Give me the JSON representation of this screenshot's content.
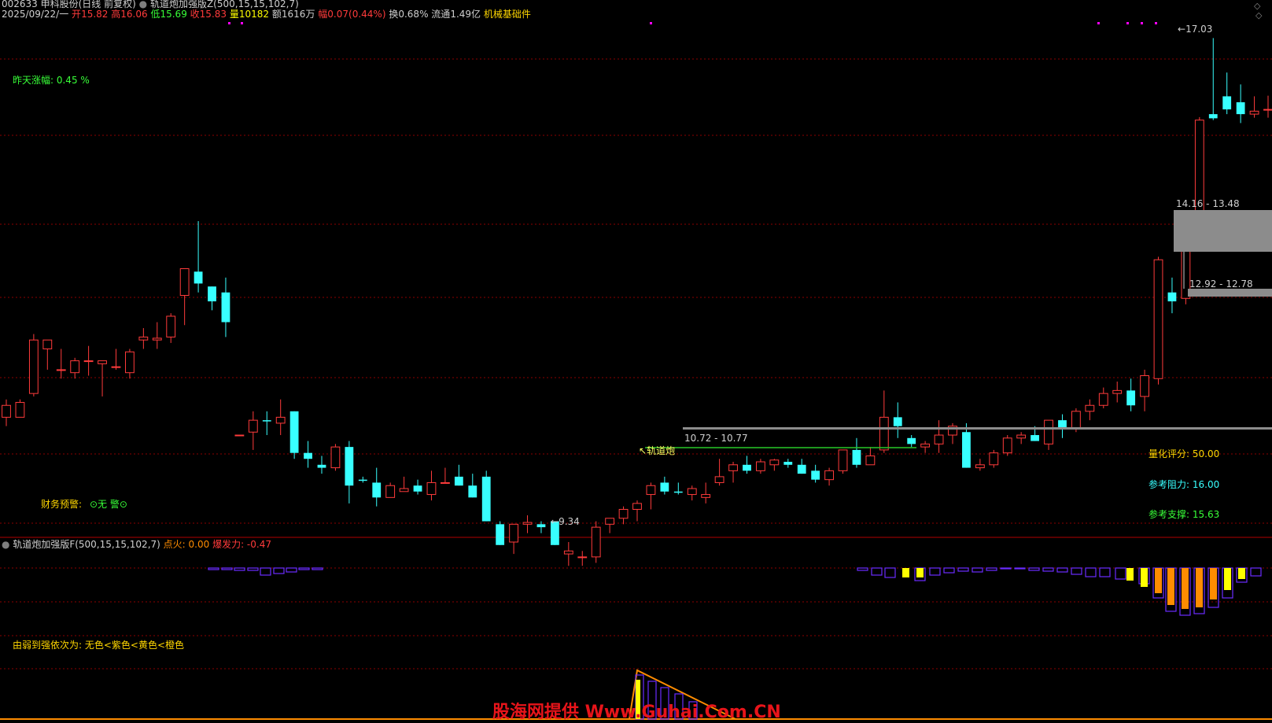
{
  "header": {
    "code_name": "002633 申科股份(日线 前复权)",
    "indicator": "轨道炮加强版Z(500,15,15,102,7)",
    "date": "2025/09/22/一",
    "open_label": "开",
    "open": "15.82",
    "high_label": "高",
    "high": "16.06",
    "low_label": "低",
    "low": "15.69",
    "close_label": "收",
    "close": "15.83",
    "vol_label": "量",
    "vol": "10182",
    "amount_label": "额",
    "amount": "1616万",
    "change_label": "幅",
    "change": "0.07(0.44%)",
    "turnover_label": "换",
    "turnover": "0.68%",
    "float_label": "流通",
    "float": "1.49亿",
    "sector": "机械基础件"
  },
  "labels": {
    "yesterday": "昨天涨幅: 0.45 %",
    "finance_warn_label": "财务预警:",
    "finance_warn_value": "⊙无 警⊙",
    "quant_score": "量化评分: 50.00",
    "resistance": "参考阻力: 16.00",
    "support": "参考支撑: 15.63",
    "sub_title": "轨道炮加强版F(500,15,15,102,7)",
    "ignite": "点火: 0.00",
    "burst": "爆发力: -0.47",
    "strength_legend": "由弱到强依次为: 无色<紫色<黄色<橙色",
    "watermark": "股海网提供 Www.Guhai.Com.CN"
  },
  "chart_data": {
    "type": "candlestick",
    "annotations": {
      "high": "17.03",
      "low": "9.34",
      "signal": "轨道炮",
      "zone_upper": "14.16 - 13.48",
      "zone_mid": "12.92 - 12.78",
      "zone_low": "10.72 - 10.77"
    },
    "ylim": [
      9.0,
      17.3
    ],
    "candles": [
      [
        10.65,
        10.95,
        10.5,
        10.85
      ],
      [
        10.65,
        10.95,
        10.65,
        10.9
      ],
      [
        11.05,
        12.05,
        11.0,
        11.95
      ],
      [
        11.8,
        11.95,
        11.45,
        11.95
      ],
      [
        11.45,
        11.8,
        11.3,
        11.45
      ],
      [
        11.4,
        11.65,
        11.3,
        11.6
      ],
      [
        11.6,
        11.85,
        11.35,
        11.6
      ],
      [
        11.55,
        11.55,
        11.0,
        11.6
      ],
      [
        11.5,
        11.8,
        11.45,
        11.5
      ],
      [
        11.4,
        11.8,
        11.3,
        11.75
      ],
      [
        11.95,
        12.15,
        11.8,
        12.0
      ],
      [
        11.95,
        12.25,
        11.8,
        11.98
      ],
      [
        12.0,
        12.4,
        11.9,
        12.35
      ],
      [
        12.7,
        13.1,
        12.2,
        13.15
      ],
      [
        13.1,
        13.95,
        12.75,
        12.9
      ],
      [
        12.85,
        12.85,
        12.45,
        12.6
      ],
      [
        12.75,
        13.0,
        12.0,
        12.25
      ],
      [
        10.35,
        10.35,
        10.35,
        10.35
      ],
      [
        10.4,
        10.75,
        10.1,
        10.6
      ],
      [
        10.6,
        10.75,
        10.35,
        10.58
      ],
      [
        10.55,
        10.95,
        10.35,
        10.65
      ],
      [
        10.75,
        10.75,
        9.95,
        10.05
      ],
      [
        10.05,
        10.25,
        9.8,
        9.95
      ],
      [
        9.85,
        10.0,
        9.7,
        9.8
      ],
      [
        9.8,
        10.2,
        9.75,
        10.15
      ],
      [
        10.15,
        10.25,
        9.2,
        9.5
      ],
      [
        9.6,
        9.65,
        9.55,
        9.58
      ],
      [
        9.55,
        9.8,
        9.15,
        9.3
      ],
      [
        9.3,
        9.55,
        9.35,
        9.5
      ],
      [
        9.4,
        9.65,
        9.4,
        9.45
      ],
      [
        9.5,
        9.6,
        9.35,
        9.4
      ],
      [
        9.35,
        9.75,
        9.25,
        9.55
      ],
      [
        9.55,
        9.8,
        9.6,
        9.55
      ],
      [
        9.65,
        9.85,
        9.7,
        9.5
      ],
      [
        9.5,
        9.7,
        9.65,
        9.3
      ],
      [
        9.65,
        9.75,
        9.55,
        8.9
      ],
      [
        8.85,
        8.9,
        8.6,
        8.5
      ],
      [
        8.55,
        8.65,
        8.35,
        8.85
      ],
      [
        8.85,
        9.0,
        8.7,
        8.88
      ],
      [
        8.85,
        8.9,
        8.7,
        8.8
      ],
      [
        8.9,
        8.6,
        8.5,
        8.5
      ],
      [
        8.35,
        8.55,
        8.15,
        8.4
      ],
      [
        8.3,
        8.4,
        8.15,
        8.3
      ],
      [
        8.3,
        8.9,
        8.2,
        8.8
      ],
      [
        8.85,
        8.9,
        8.7,
        8.95
      ],
      [
        8.95,
        9.15,
        8.85,
        9.1
      ],
      [
        9.1,
        9.25,
        8.9,
        9.2
      ],
      [
        9.35,
        9.55,
        9.1,
        9.5
      ],
      [
        9.55,
        9.65,
        9.35,
        9.4
      ],
      [
        9.4,
        9.55,
        9.35,
        9.38
      ],
      [
        9.35,
        9.5,
        9.25,
        9.45
      ],
      [
        9.3,
        9.55,
        9.2,
        9.35
      ],
      [
        9.55,
        9.95,
        9.5,
        9.65
      ],
      [
        9.75,
        9.9,
        9.55,
        9.85
      ],
      [
        9.85,
        10.0,
        9.7,
        9.75
      ],
      [
        9.75,
        9.95,
        9.7,
        9.9
      ],
      [
        9.85,
        9.95,
        9.75,
        9.93
      ],
      [
        9.9,
        9.95,
        9.8,
        9.85
      ],
      [
        9.85,
        9.95,
        9.75,
        9.7
      ],
      [
        9.75,
        9.85,
        9.55,
        9.6
      ],
      [
        9.6,
        9.8,
        9.5,
        9.75
      ],
      [
        9.75,
        10.05,
        9.7,
        10.1
      ],
      [
        10.1,
        10.3,
        9.8,
        9.85
      ],
      [
        9.85,
        10.15,
        9.85,
        10.0
      ],
      [
        10.1,
        11.1,
        10.05,
        10.65
      ],
      [
        10.65,
        10.9,
        10.3,
        10.5
      ],
      [
        10.3,
        10.35,
        10.15,
        10.2
      ],
      [
        10.15,
        10.25,
        10.05,
        10.2
      ],
      [
        10.2,
        10.6,
        10.05,
        10.35
      ],
      [
        10.35,
        10.55,
        10.2,
        10.5
      ],
      [
        10.4,
        10.55,
        9.9,
        9.8
      ],
      [
        9.8,
        9.95,
        9.75,
        9.85
      ],
      [
        9.85,
        10.1,
        9.8,
        10.05
      ],
      [
        10.05,
        10.35,
        10.0,
        10.3
      ],
      [
        10.3,
        10.4,
        10.2,
        10.35
      ],
      [
        10.35,
        10.5,
        10.25,
        10.25
      ],
      [
        10.2,
        10.6,
        10.1,
        10.6
      ],
      [
        10.6,
        10.7,
        10.3,
        10.45
      ],
      [
        10.45,
        10.8,
        10.4,
        10.75
      ],
      [
        10.75,
        10.95,
        10.6,
        10.85
      ],
      [
        10.85,
        11.15,
        10.8,
        11.05
      ],
      [
        11.05,
        11.25,
        10.9,
        11.1
      ],
      [
        11.1,
        11.3,
        10.75,
        10.85
      ],
      [
        11.0,
        11.45,
        10.75,
        11.35
      ],
      [
        11.3,
        13.35,
        11.2,
        13.3
      ],
      [
        12.75,
        13.0,
        12.4,
        12.6
      ],
      [
        12.65,
        13.65,
        12.55,
        14.0
      ],
      [
        14.05,
        15.7,
        13.8,
        15.65
      ],
      [
        15.75,
        17.03,
        15.65,
        15.68
      ],
      [
        16.05,
        16.45,
        15.75,
        15.83
      ],
      [
        15.95,
        16.25,
        15.6,
        15.75
      ],
      [
        15.75,
        16.05,
        15.69,
        15.8
      ],
      [
        15.82,
        16.06,
        15.69,
        15.83
      ]
    ],
    "volume_bars": [
      {
        "kind": "purple",
        "v": -2
      },
      {
        "kind": "purple",
        "v": -2
      },
      {
        "kind": "purple",
        "v": -3
      },
      {
        "kind": "purple",
        "v": -3
      },
      {
        "kind": "purple",
        "v": -3
      },
      {
        "kind": "purple",
        "v": -2
      },
      {
        "kind": "purple",
        "v": -1
      },
      {
        "kind": "purple",
        "v": -1
      }
    ]
  }
}
